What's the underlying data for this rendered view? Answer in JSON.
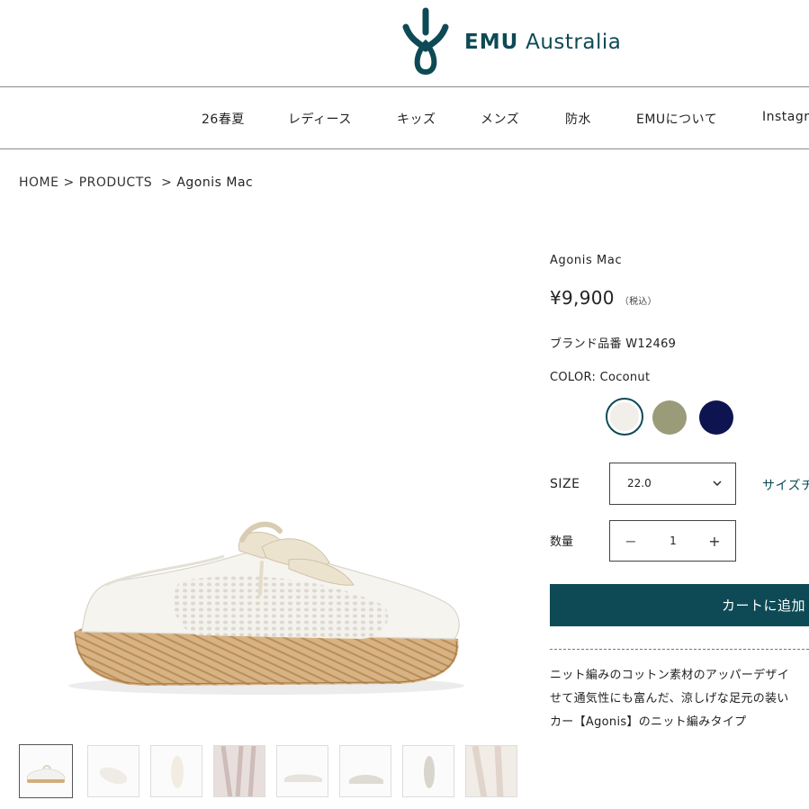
{
  "header": {
    "logo_brand": "EMU",
    "logo_suffix": "Australia",
    "brand_color": "#0e4a55"
  },
  "nav": {
    "items": [
      "26春夏",
      "レディース",
      "キッズ",
      "メンズ",
      "防水",
      "EMUについて",
      "Instagra"
    ]
  },
  "breadcrumb": {
    "home": "HOME",
    "separator": ">",
    "products": "PRODUCTS",
    "current": "Agonis Mac"
  },
  "product": {
    "name": "Agonis Mac",
    "price": "¥9,900",
    "tax_note": "（税込）",
    "sku": "ブランド品番 W12469",
    "color_label": "COLOR: Coconut",
    "swatches": [
      {
        "name": "Coconut",
        "color": "#f2efea",
        "selected": true
      },
      {
        "name": "Olive",
        "color": "#999b79",
        "selected": false
      },
      {
        "name": "Navy",
        "color": "#0e1450",
        "selected": false
      }
    ],
    "size_label": "SIZE",
    "size_value": "22.0",
    "size_chart": "サイズチ",
    "qty_label": "数量",
    "qty_minus": "−",
    "qty_value": "1",
    "qty_plus": "+",
    "cart_button": "カートに追加",
    "description": [
      "ニット編みのコットン素材のアッパーデザイ",
      "せて通気性にも富んだ、涼しげな足元の装い",
      "カー【Agonis】のニット編みタイプ"
    ]
  },
  "thumbnails": [
    {
      "name": "thumb-1",
      "active": true
    },
    {
      "name": "thumb-2",
      "active": false
    },
    {
      "name": "thumb-3",
      "active": false
    },
    {
      "name": "thumb-4",
      "active": false
    },
    {
      "name": "thumb-5",
      "active": false
    },
    {
      "name": "thumb-6",
      "active": false
    },
    {
      "name": "thumb-7",
      "active": false
    },
    {
      "name": "thumb-8",
      "active": false
    }
  ]
}
